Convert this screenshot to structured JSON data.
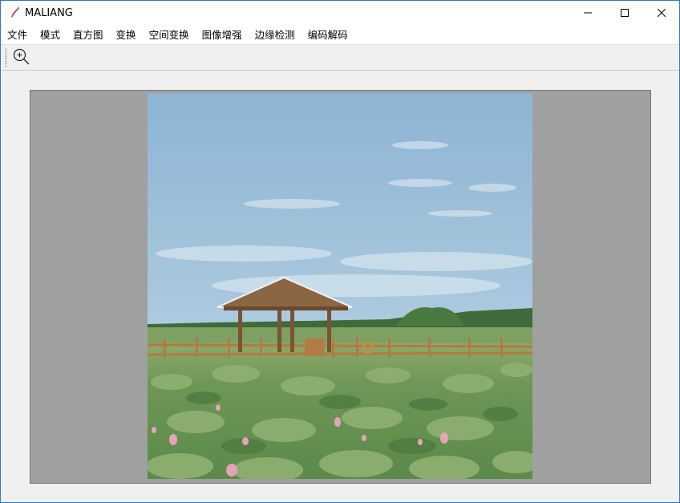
{
  "window": {
    "title": "MALIANG",
    "icon": "brush-icon",
    "controls": [
      "minimize-icon",
      "maximize-icon",
      "close-icon"
    ]
  },
  "menu": {
    "items": [
      {
        "label": "文件"
      },
      {
        "label": "模式"
      },
      {
        "label": "直方图"
      },
      {
        "label": "变换"
      },
      {
        "label": "空间变换"
      },
      {
        "label": "图像增强"
      },
      {
        "label": "边缘检测"
      },
      {
        "label": "编码解码"
      }
    ]
  },
  "toolbar": {
    "tools": [
      {
        "icon": "zoom-in-icon"
      }
    ]
  },
  "image": {
    "subject": "lotus pond with wooden pavilion under blue sky",
    "colors": {
      "panel": "#a0a0a0",
      "sky_top": "#8fb6d6",
      "sky_bottom": "#d9e6ee",
      "leaves": "#6e9a58",
      "wood": "#b07b45",
      "flowers": "#e8a2b8"
    }
  }
}
